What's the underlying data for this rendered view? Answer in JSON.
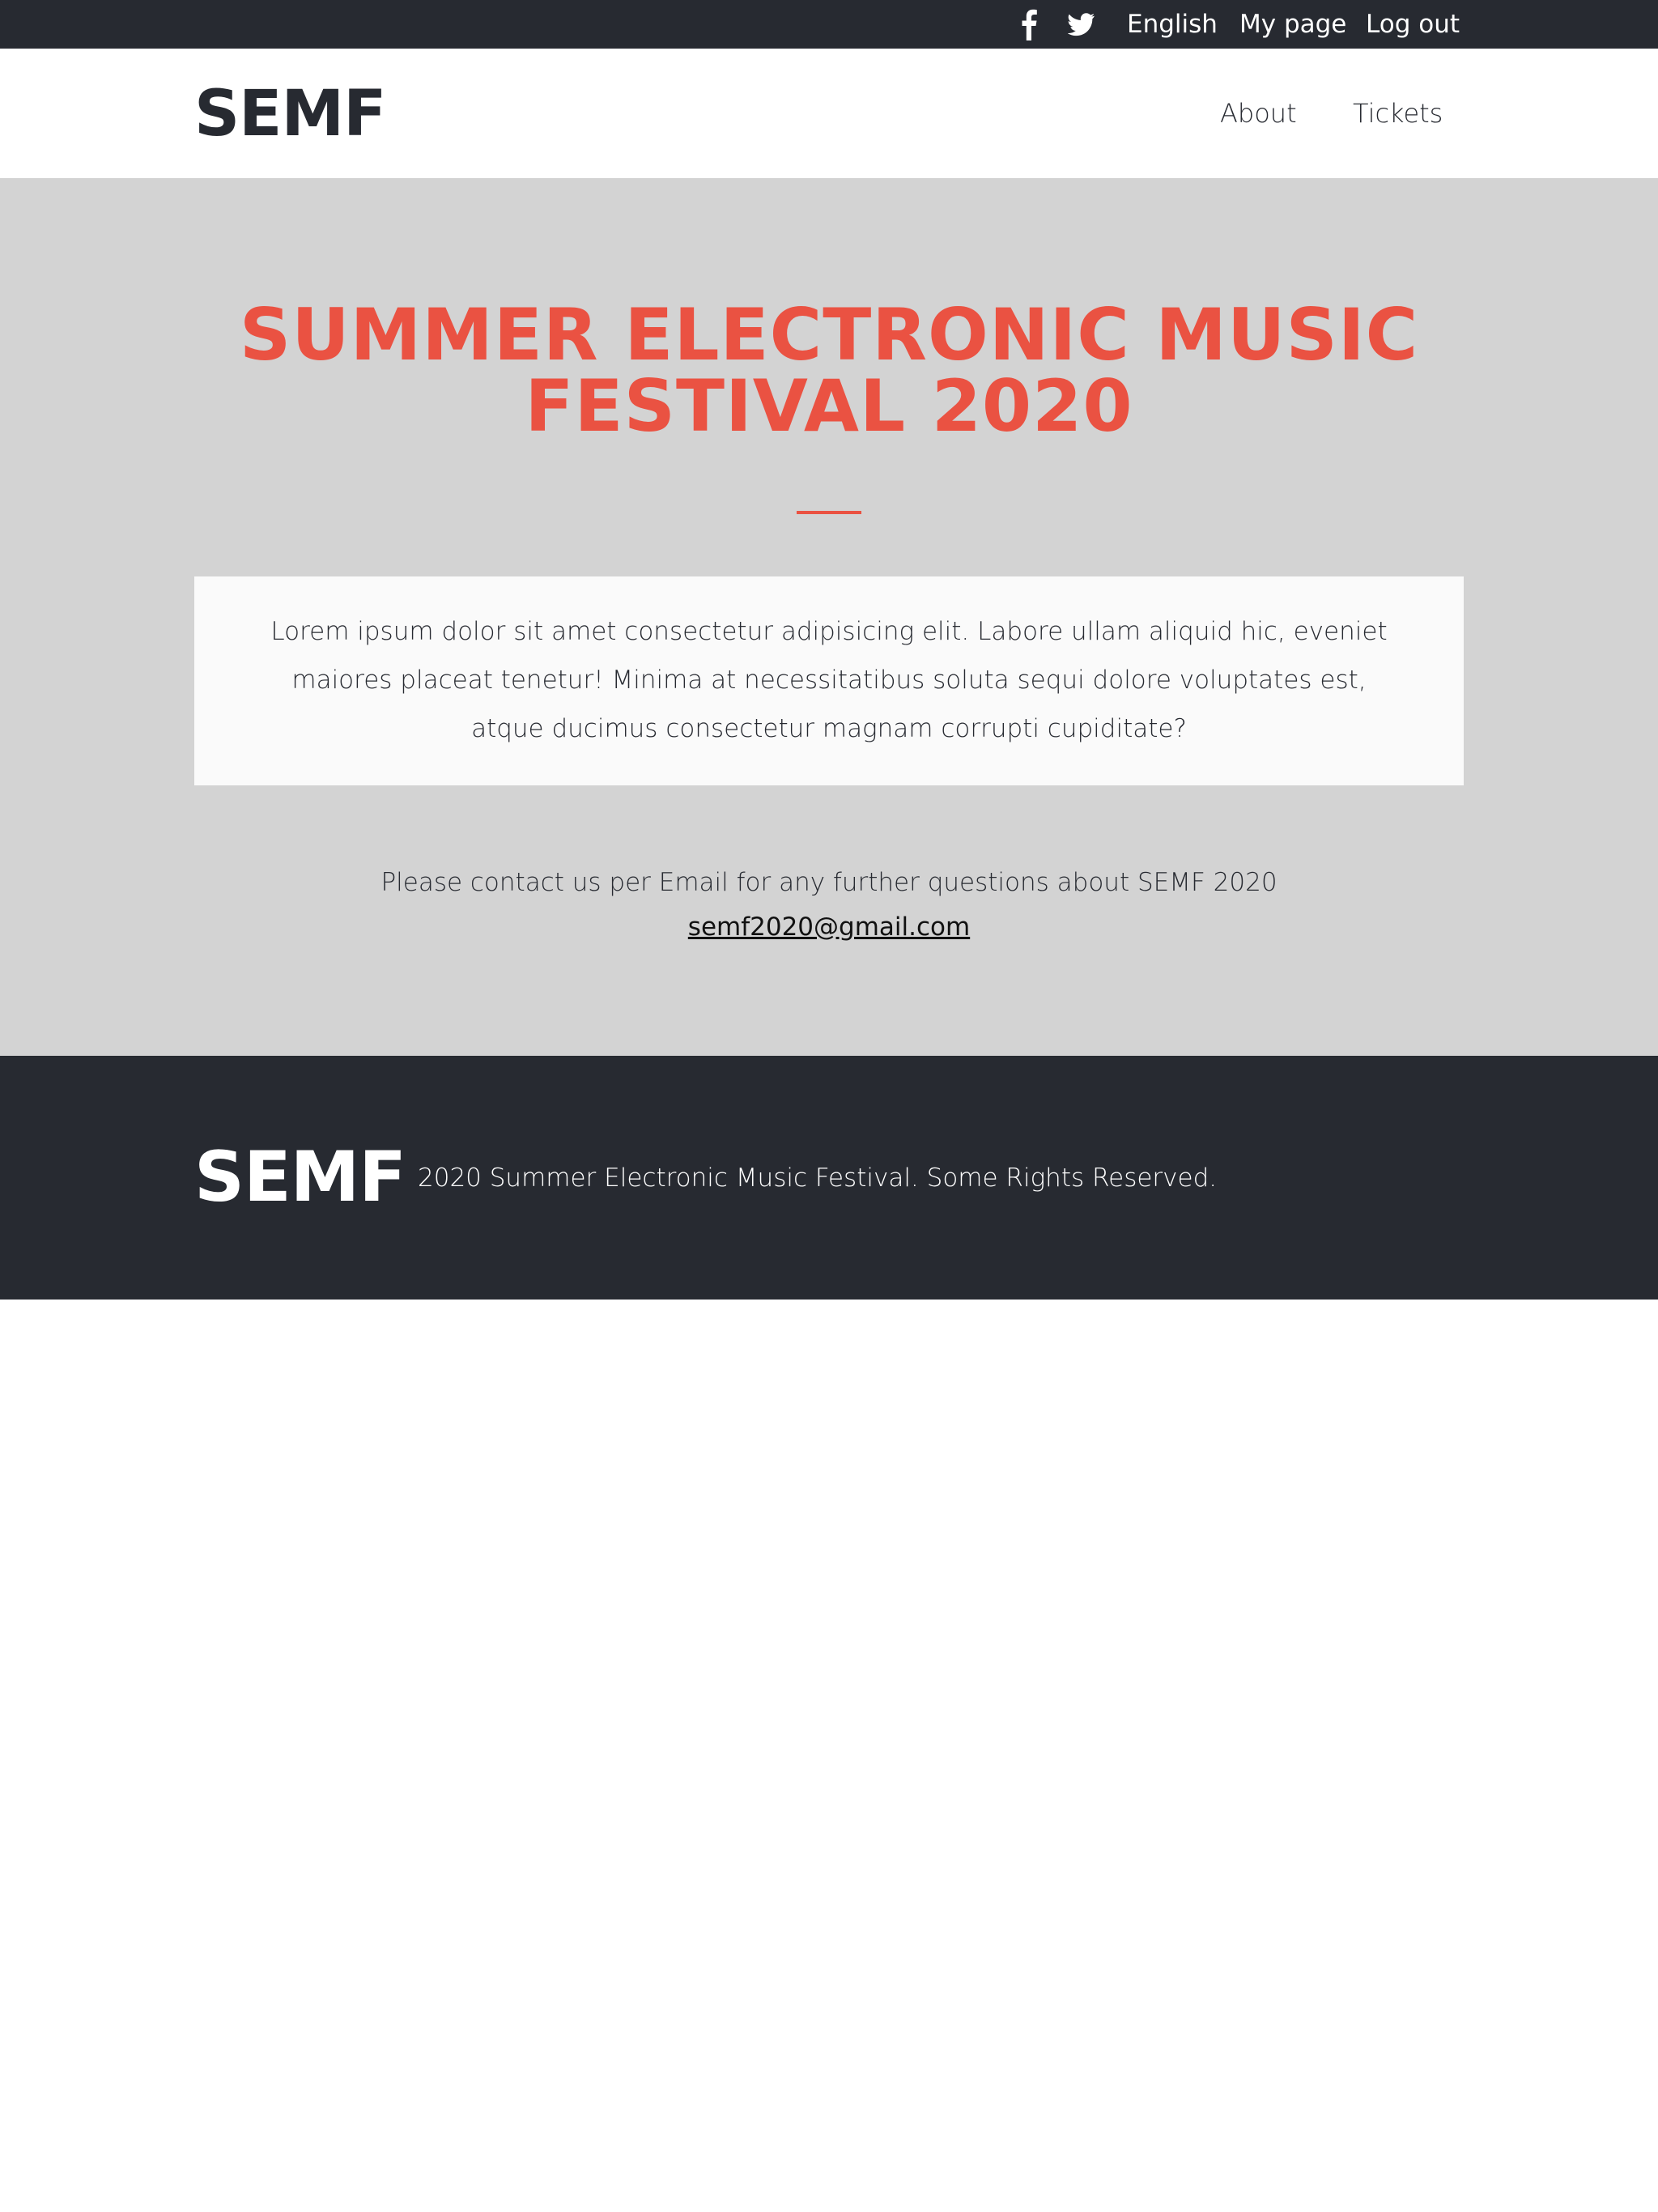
{
  "topbar": {
    "icons": [
      "facebook-icon",
      "twitter-icon"
    ],
    "language": "English",
    "my_page": "My page",
    "logout": "Log out"
  },
  "header": {
    "logo": "SEMF",
    "nav": [
      "About",
      "Tickets"
    ]
  },
  "hero": {
    "title_line1": "SUMMER ELECTRONIC MUSIC",
    "title_line2": "FESTIVAL 2020",
    "description": "Lorem ipsum dolor sit amet consectetur adipisicing elit. Labore ullam aliquid hic, eveniet maiores placeat tenetur! Minima at necessitatibus soluta sequi dolore voluptates est, atque ducimus consectetur magnam corrupti cupiditate?",
    "contact_text": "Please contact us per Email for any further questions about SEMF 2020",
    "contact_email": "semf2020@gmail.com"
  },
  "footer": {
    "logo": "SEMF",
    "copyright": "2020 Summer Electronic Music Festival. Some Rights Reserved."
  },
  "colors": {
    "dark": "#272a31",
    "accent": "#ea5242",
    "hero_bg": "#d3d3d3",
    "card_bg": "#fafafa"
  }
}
